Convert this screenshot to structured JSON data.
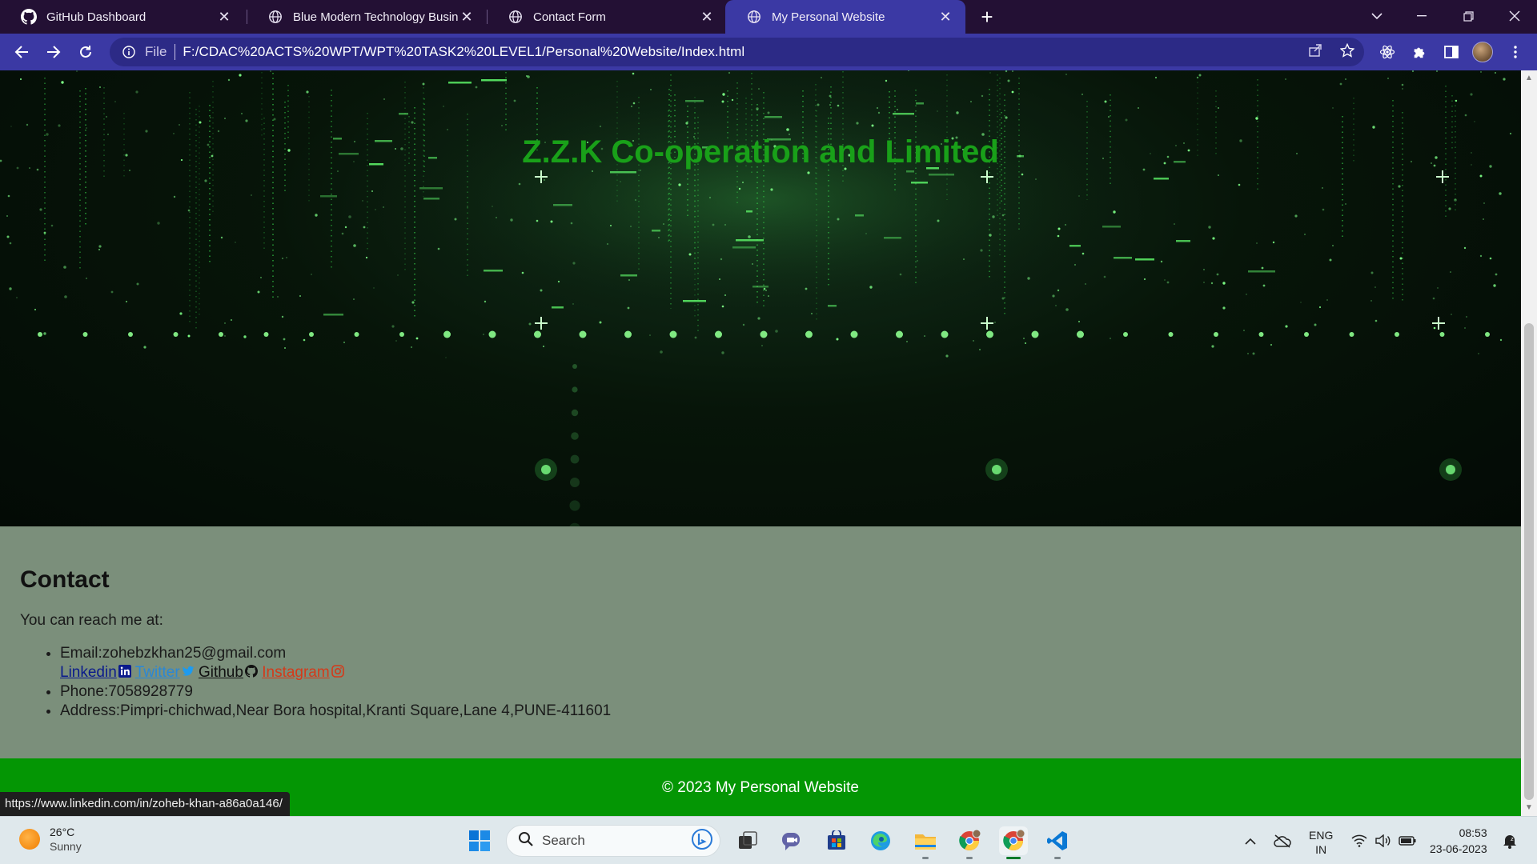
{
  "browser": {
    "tabs": [
      {
        "title": "GitHub Dashboard",
        "favicon": "github-icon",
        "active": false
      },
      {
        "title": "Blue Modern Technology Business",
        "favicon": "globe-icon",
        "active": false
      },
      {
        "title": "Contact Form",
        "favicon": "globe-icon",
        "active": false
      },
      {
        "title": "My Personal Website",
        "favicon": "globe-icon",
        "active": true
      }
    ],
    "address": {
      "scheme": "File",
      "url": "F:/CDAC%20ACTS%20WPT/WPT%20TASK2%20LEVEL1/Personal%20Website/Index.html"
    },
    "colors": {
      "tabstrip": "#231034",
      "toolbar": "#3b39a4"
    }
  },
  "page": {
    "hero_title": "Z.Z.K Co-operation and Limited",
    "contact": {
      "heading": "Contact",
      "intro": "You can reach me at:",
      "email": "Email:zohebzkhan25@gmail.com",
      "links": {
        "linkedin": "Linkedin",
        "twitter": "Twitter",
        "github": "Github",
        "instagram": "Instagram"
      },
      "phone": "Phone:7058928779",
      "address": "Address:Pimpri-chichwad,Near Bora hospital,Kranti Square,Lane 4,PUNE-411601"
    },
    "footer": "© 2023 My Personal Website",
    "colors": {
      "contact_bg": "#7b8f7b",
      "footer_bg": "#049604",
      "title": "#19a019"
    }
  },
  "status_url": "https://www.linkedin.com/in/zoheb-khan-a86a0a146/",
  "taskbar": {
    "weather": {
      "temp": "26°C",
      "condition": "Sunny"
    },
    "search_placeholder": "Search",
    "lang_top": "ENG",
    "lang_bottom": "IN",
    "time": "08:53",
    "date": "23-06-2023"
  }
}
